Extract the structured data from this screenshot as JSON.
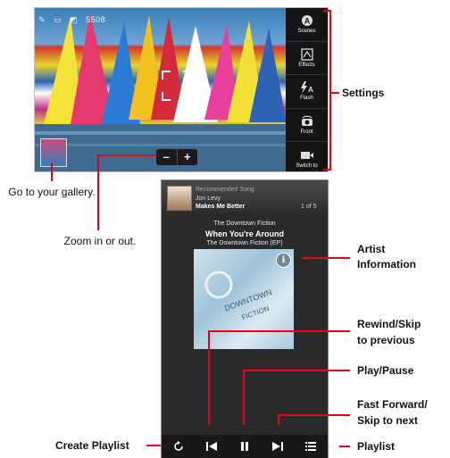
{
  "camera": {
    "status_text": "5508",
    "zoom": {
      "minus": "–",
      "plus": "+"
    },
    "sidebar": [
      {
        "label": "Scenes",
        "icon": "scenes-icon"
      },
      {
        "label": "Effects",
        "icon": "effects-icon"
      },
      {
        "label": "Flash",
        "icon": "flash-icon"
      },
      {
        "label": "Front",
        "icon": "front-camera-icon"
      },
      {
        "label": "Switch to",
        "icon": "video-camera-icon"
      }
    ]
  },
  "music": {
    "recommended": {
      "heading": "Recommended Song",
      "artist": "Jon Levy",
      "song": "Makes Me Better",
      "count": "1 of 5"
    },
    "now_playing": {
      "artist": "The Downtown Fiction",
      "title": "When You're Around",
      "album": "The Downtown Fiction (EP)"
    },
    "info_icon": "i"
  },
  "callouts": {
    "settings": "Settings",
    "gallery": "Go to your gallery.",
    "zoom": "Zoom in or out.",
    "artist_info_line1": "Artist",
    "artist_info_line2": "Information",
    "rewind_line1": "Rewind/Skip",
    "rewind_line2": "to previous",
    "play_pause": "Play/Pause",
    "ff_line1": "Fast Forward/",
    "ff_line2": "Skip to next",
    "create_playlist": "Create Playlist",
    "playlist": "Playlist"
  },
  "colors": {
    "callout_line": "#e2001a"
  }
}
